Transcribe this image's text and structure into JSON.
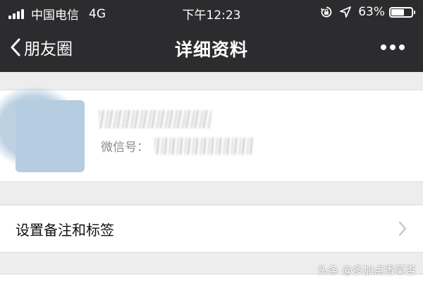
{
  "status_bar": {
    "carrier": "中国电信",
    "network": "4G",
    "time": "下午12:23",
    "battery_percent_label": "63%",
    "battery_level": 0.63
  },
  "nav": {
    "back_label": "朋友圈",
    "title": "详细资料"
  },
  "profile": {
    "wechat_id_label": "微信号："
  },
  "remarks": {
    "label": "设置备注和标签"
  },
  "watermark": {
    "text": "头条 @多加点香菜否"
  },
  "colors": {
    "header_bg": "#2c2c2e",
    "page_bg": "#ededed",
    "card_bg": "#ffffff",
    "avatar": "#b6cce0"
  }
}
